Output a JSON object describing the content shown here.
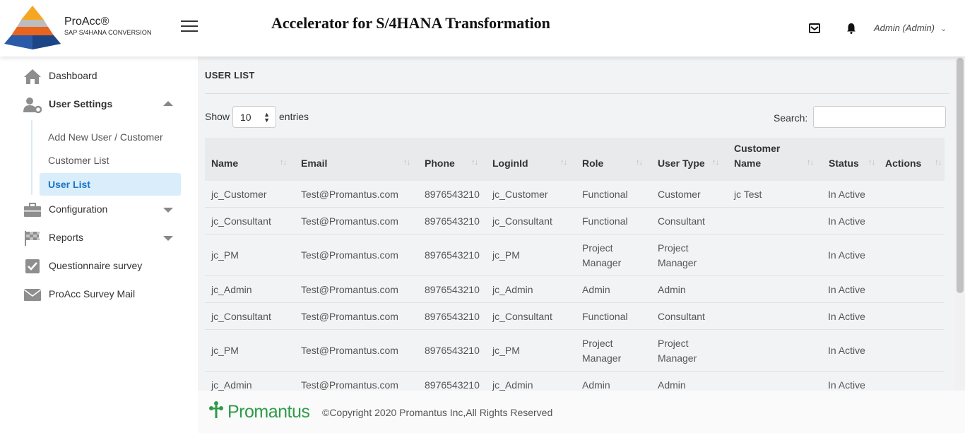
{
  "header": {
    "logo_title": "ProAcc®",
    "logo_subtitle": "SAP S/4HANA CONVERSION",
    "app_title": "Accelerator for S/4HANA Transformation",
    "user_label": "Admin (Admin)"
  },
  "sidebar": {
    "items": [
      {
        "label": "Dashboard",
        "icon": "home-icon"
      },
      {
        "label": "User Settings",
        "icon": "user-settings-icon",
        "expanded": true
      },
      {
        "label": "Configuration",
        "icon": "briefcase-icon"
      },
      {
        "label": "Reports",
        "icon": "checkered-flag-icon"
      },
      {
        "label": "Questionnaire survey",
        "icon": "checkbox-icon"
      },
      {
        "label": "ProAcc Survey Mail",
        "icon": "envelope-icon"
      }
    ],
    "subitems": [
      {
        "label": "Add New User / Customer"
      },
      {
        "label": "Customer List"
      },
      {
        "label": "User List",
        "active": true
      }
    ]
  },
  "main": {
    "page_title": "USER LIST",
    "show_label": "Show",
    "entries_value": "10",
    "entries_label": "entries",
    "search_label": "Search:"
  },
  "table": {
    "columns": [
      "Name",
      "Email",
      "Phone",
      "LoginId",
      "Role",
      "User Type",
      "Customer Name",
      "Status",
      "Actions"
    ],
    "rows": [
      {
        "name": "jc_Customer",
        "email": "Test@Promantus.com",
        "phone": "8976543210",
        "loginid": "jc_Customer",
        "role": "Functional",
        "user_type": "Customer",
        "customer_name": "jc Test",
        "status": "In Active",
        "actions": ""
      },
      {
        "name": "jc_Consultant",
        "email": "Test@Promantus.com",
        "phone": "8976543210",
        "loginid": "jc_Consultant",
        "role": "Functional",
        "user_type": "Consultant",
        "customer_name": "",
        "status": "In Active",
        "actions": ""
      },
      {
        "name": "jc_PM",
        "email": "Test@Promantus.com",
        "phone": "8976543210",
        "loginid": "jc_PM",
        "role": "Project Manager",
        "user_type": "Project Manager",
        "customer_name": "",
        "status": "In Active",
        "actions": ""
      },
      {
        "name": "jc_Admin",
        "email": "Test@Promantus.com",
        "phone": "8976543210",
        "loginid": "jc_Admin",
        "role": "Admin",
        "user_type": "Admin",
        "customer_name": "",
        "status": "In Active",
        "actions": ""
      },
      {
        "name": "jc_Consultant",
        "email": "Test@Promantus.com",
        "phone": "8976543210",
        "loginid": "jc_Consultant",
        "role": "Functional",
        "user_type": "Consultant",
        "customer_name": "",
        "status": "In Active",
        "actions": ""
      },
      {
        "name": "jc_PM",
        "email": "Test@Promantus.com",
        "phone": "8976543210",
        "loginid": "jc_PM",
        "role": "Project Manager",
        "user_type": "Project Manager",
        "customer_name": "",
        "status": "In Active",
        "actions": ""
      },
      {
        "name": "jc_Admin",
        "email": "Test@Promantus.com",
        "phone": "8976543210",
        "loginid": "jc_Admin",
        "role": "Admin",
        "user_type": "Admin",
        "customer_name": "",
        "status": "In Active",
        "actions": ""
      }
    ]
  },
  "footer": {
    "brand": "Promantus",
    "copyright": "©Copyright 2020 Promantus Inc,All Rights Reserved"
  },
  "colors": {
    "accent": "#1a73c9",
    "active_bg": "#d9eefa",
    "brand_green": "#2e9a4a",
    "table_header_bg": "#e9eaec"
  }
}
